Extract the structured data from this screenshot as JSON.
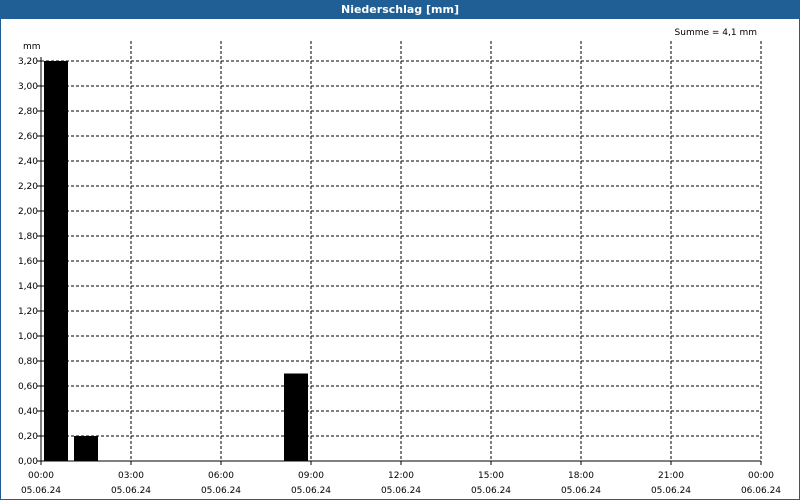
{
  "window": {
    "title": "Niederschlag [mm]"
  },
  "summary": {
    "text": "Summe = 4,1 mm"
  },
  "chart_data": {
    "type": "bar",
    "title": "Niederschlag [mm]",
    "ylabel": "mm",
    "xlabel": "",
    "ylim": [
      0,
      3.2
    ],
    "y_ticks": [
      "0,00",
      "0,20",
      "0,40",
      "0,60",
      "0,80",
      "1,00",
      "1,20",
      "1,40",
      "1,60",
      "1,80",
      "2,00",
      "2,20",
      "2,40",
      "2,60",
      "2,80",
      "3,00",
      "3,20"
    ],
    "x_range_hours": [
      0,
      24
    ],
    "x_ticks": [
      {
        "time": "00:00",
        "date": "05.06.24"
      },
      {
        "time": "03:00",
        "date": "05.06.24"
      },
      {
        "time": "06:00",
        "date": "05.06.24"
      },
      {
        "time": "09:00",
        "date": "05.06.24"
      },
      {
        "time": "12:00",
        "date": "05.06.24"
      },
      {
        "time": "15:00",
        "date": "05.06.24"
      },
      {
        "time": "18:00",
        "date": "05.06.24"
      },
      {
        "time": "21:00",
        "date": "05.06.24"
      },
      {
        "time": "00:00",
        "date": "06.06.24"
      }
    ],
    "bars": [
      {
        "start_hour": 0,
        "end_hour": 1,
        "value": 3.2
      },
      {
        "start_hour": 1,
        "end_hour": 2,
        "value": 0.2
      },
      {
        "start_hour": 8,
        "end_hour": 9,
        "value": 0.7
      }
    ],
    "grid": true,
    "grid_style": "dashed",
    "bar_color": "#000000",
    "sum": "4,1 mm"
  }
}
